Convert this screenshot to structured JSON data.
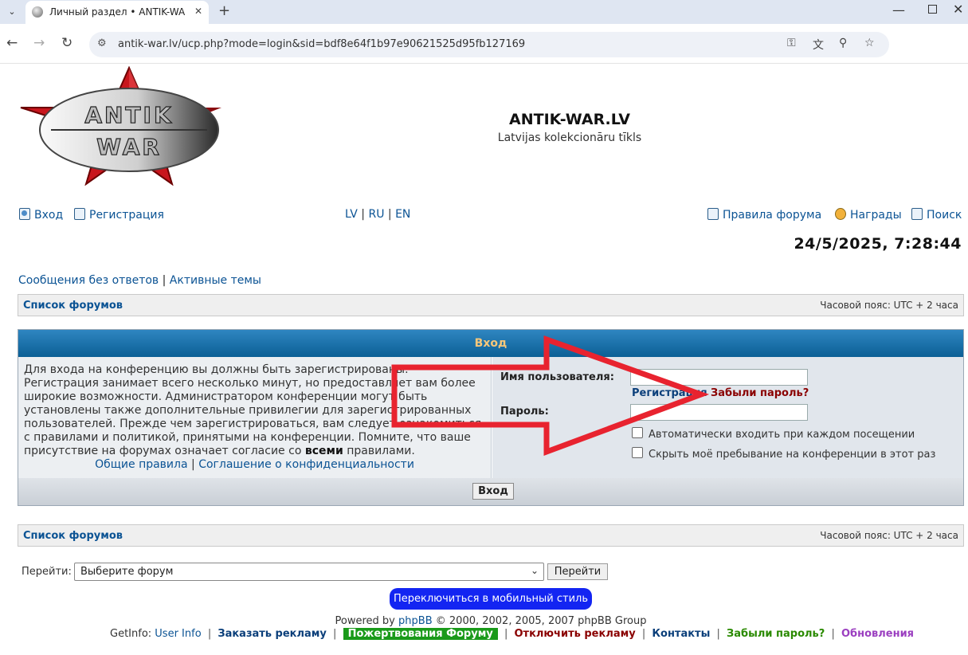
{
  "browser": {
    "tab_title": "Личный раздел • ANTIK-WAR.LV",
    "url": "antik-war.lv/ucp.php?mode=login&sid=bdf8e64f1b97e90621525d95fb127169"
  },
  "header": {
    "site_name": "ANTIK-WAR.LV",
    "site_description": "Latvijas kolekcionāru tīkls",
    "logo_text_top": "ANTIK",
    "logo_text_bottom": "WAR"
  },
  "toplinks": {
    "login": "Вход",
    "register": "Регистрация",
    "lang_lv": "LV",
    "lang_ru": "RU",
    "lang_en": "EN",
    "lang_sep": "|",
    "rules": "Правила форума",
    "awards": "Награды",
    "search": "Поиск"
  },
  "clock": "24/5/2025, 7:28:44",
  "quicklinks": {
    "unanswered": "Сообщения без ответов",
    "separator": "|",
    "active": "Активные темы"
  },
  "navbar": {
    "forum_list": "Список форумов",
    "timezone": "Часовой пояс: UTC + 2 часа"
  },
  "login": {
    "header": "Вход",
    "info_text": "Для входа на конференцию вы должны быть зарегистрированы. Регистрация занимает всего несколько минут, но предоставляет вам более широкие возможности. Администратором конференции могут быть установлены также дополнительные привилегии для зарегистрированных пользователей. Прежде чем зарегистрироваться, вам следует ознакомиться с правилами и политикой, принятыми на конференции. Помните, что ваше присутствие на форумах означает согласие со",
    "info_bold": "всеми",
    "info_tail": "правилами.",
    "general_rules": "Общие правила",
    "links_sep": "|",
    "privacy": "Соглашение о конфиденциальности",
    "username_label": "Имя пользователя:",
    "register_link": "Регистрация",
    "forgot_link": "Забыли пароль?",
    "password_label": "Пароль:",
    "autologin": "Автоматически входить при каждом посещении",
    "hide_online": "Скрыть моё пребывание на конференции в этот раз",
    "submit": "Вход"
  },
  "jump": {
    "label": "Перейти:",
    "selected": "Выберите форум",
    "button": "Перейти"
  },
  "mobile_button": "Переключиться в мобильный стиль",
  "footer": {
    "powered_prefix": "Powered by",
    "phpbb": "phpBB",
    "powered_suffix": "© 2000, 2002, 2005, 2007 phpBB Group",
    "getinfo_label": "GetInfo:",
    "user_info": "User Info",
    "order_ads": "Заказать рекламу",
    "donate": "Пожертвования Форуму",
    "disable_ads": "Отключить рекламу",
    "contacts": "Контакты",
    "forgot_password": "Забыли пароль?",
    "updates": "Обновления",
    "sep": "|"
  },
  "colors": {
    "link": "#0b5394",
    "header_bar": "#0b5f95",
    "overlay_arrow": "#e8232f",
    "mobile_button": "#1325f2"
  }
}
